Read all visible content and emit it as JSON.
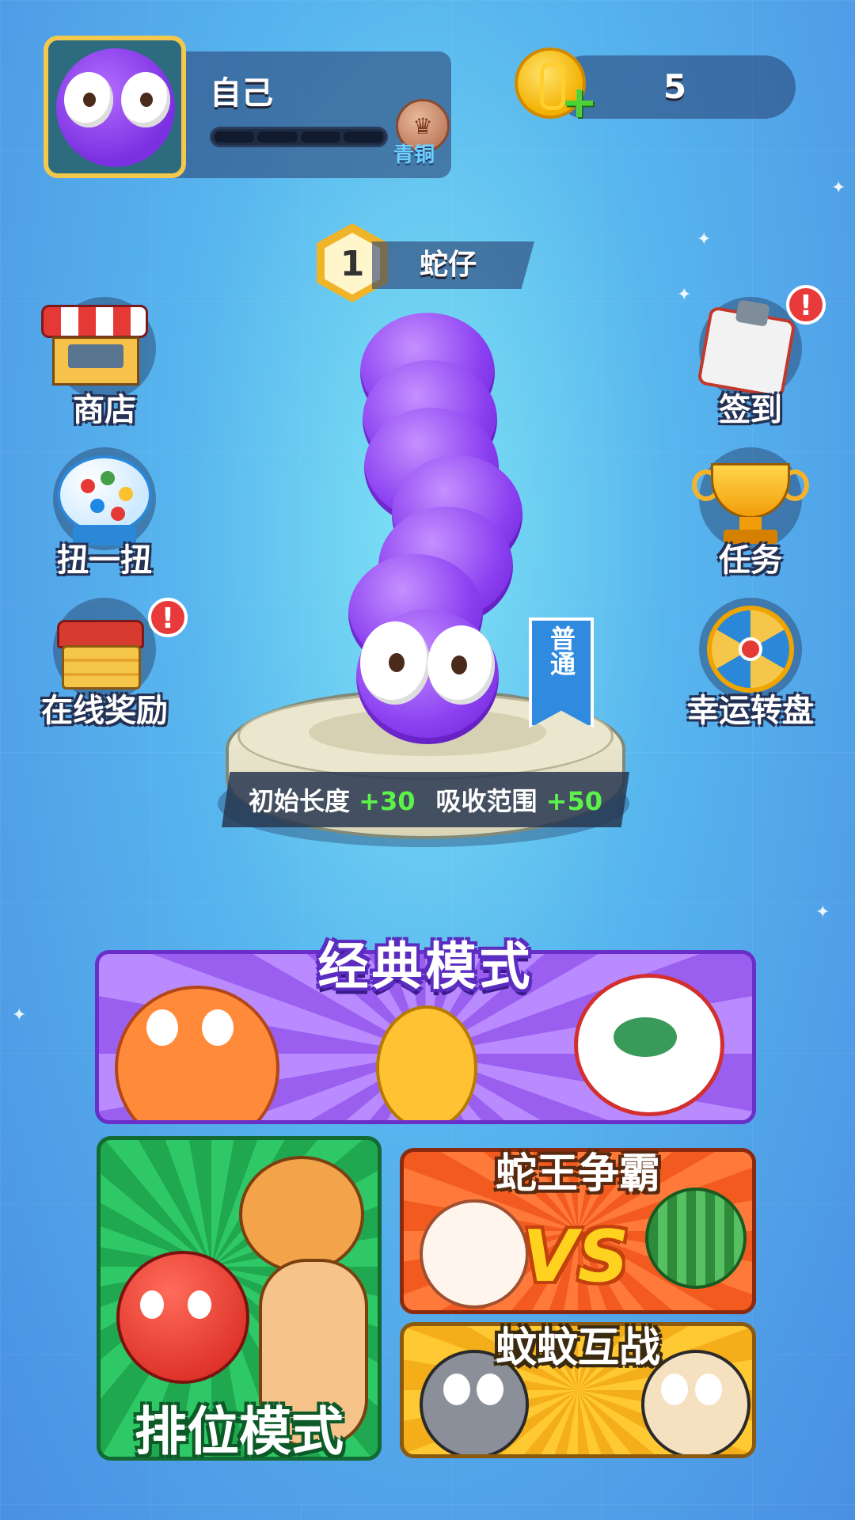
{
  "player": {
    "name": "自己",
    "rank": "青铜",
    "xp_segments": 4
  },
  "currency": {
    "coins": "5",
    "add_icon": "plus-icon"
  },
  "snake": {
    "level": "1",
    "name": "蛇仔",
    "quality": "普通",
    "stats": [
      {
        "label": "初始长度",
        "bonus": "+30"
      },
      {
        "label": "吸收范围",
        "bonus": "+50"
      }
    ]
  },
  "left_menu": [
    {
      "label": "商店",
      "icon": "shop-icon"
    },
    {
      "label": "扭一扭",
      "icon": "gacha-icon"
    },
    {
      "label": "在线奖励",
      "icon": "treasure-chest-icon",
      "alert": "!"
    }
  ],
  "right_menu": [
    {
      "label": "签到",
      "icon": "checkin-icon",
      "alert": "!"
    },
    {
      "label": "任务",
      "icon": "trophy-icon"
    },
    {
      "label": "幸运转盘",
      "icon": "lucky-wheel-icon"
    }
  ],
  "modes": {
    "classic": "经典模式",
    "ranked": "排位模式",
    "king": "蛇王争霸",
    "king_vs": "VS",
    "mosquito": "蚊蚊互战"
  },
  "colors": {
    "accent_purple": "#8a3ff0",
    "coin_gold": "#f3b000",
    "plus_green": "#5cf24a"
  }
}
